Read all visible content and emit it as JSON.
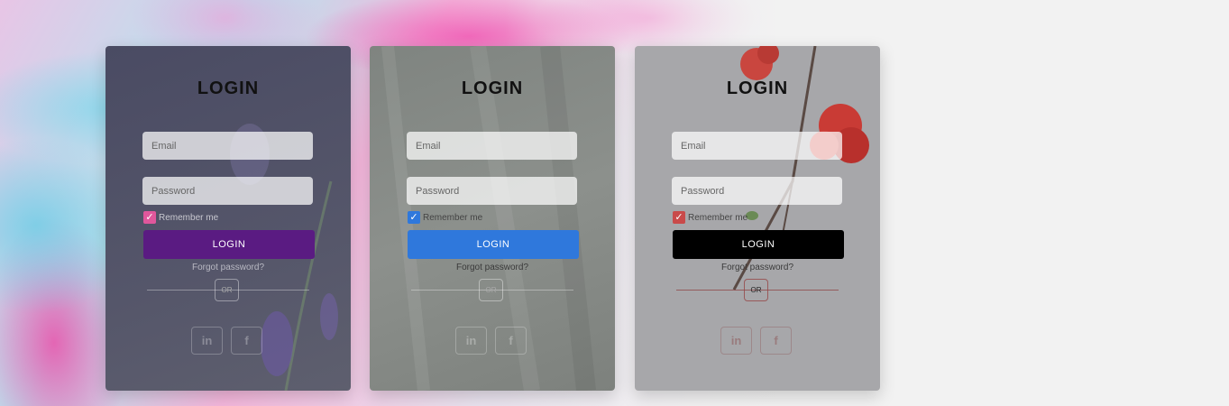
{
  "cards": [
    {
      "title": "LOGIN",
      "email_placeholder": "Email",
      "password_placeholder": "Password",
      "remember_label": "Remember me",
      "login_label": "LOGIN",
      "forgot_label": "Forgot password?",
      "or_label": "OR",
      "linkedin_icon": "in",
      "facebook_icon": "f",
      "accent_color": "#5a1b82",
      "checkbox_color": "#e0579c"
    },
    {
      "title": "LOGIN",
      "email_placeholder": "Email",
      "password_placeholder": "Password",
      "remember_label": "Remember me",
      "login_label": "LOGIN",
      "forgot_label": "Forgot password?",
      "or_label": "OR",
      "linkedin_icon": "in",
      "facebook_icon": "f",
      "accent_color": "#2f78dc",
      "checkbox_color": "#2f78dc"
    },
    {
      "title": "LOGIN",
      "email_placeholder": "Email",
      "password_placeholder": "Password",
      "remember_label": "Remember me",
      "login_label": "LOGIN",
      "forgot_label": "Forgot password?",
      "or_label": "OR",
      "linkedin_icon": "in",
      "facebook_icon": "f",
      "accent_color": "#000000",
      "checkbox_color": "#c94a4a"
    }
  ]
}
